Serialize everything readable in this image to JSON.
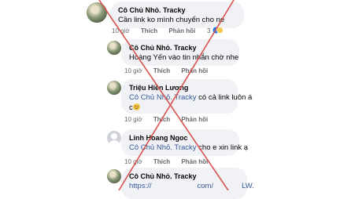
{
  "comments": [
    {
      "name": "Cô Chủ Nhỏ. Tracky",
      "text": "Cần link ko mình chuyển cho ne",
      "time": "10 giờ",
      "like": "Thích",
      "reply": "Phản hồi",
      "reaction_count": "3"
    },
    {
      "name": "Cô Chủ Nhỏ. Tracky",
      "text": "Hoàng Yến vào tin nhắn  chờ nhe",
      "time": "10 giờ",
      "like": "Thích",
      "reply": "Phản hồi"
    },
    {
      "name": "Triệu Hiền Lương",
      "mention": "Cô Chủ Nhỏ. Tracky",
      "text": " có cả link luôn á",
      "text2": "c",
      "time": "10 giờ",
      "like": "Thích",
      "reply": "Phản hồi"
    },
    {
      "name": "Linh Hoang Ngoc",
      "mention": "Cô Chủ Nhỏ. Tracky",
      "text": " cho e xin link ạ",
      "time": "10 giờ",
      "like": "Thích",
      "reply": "Phản hồi"
    },
    {
      "name": "Cô Chủ Nhỏ. Tracky",
      "link_start": "https://",
      "link_mid": "com/",
      "link_end": "LW."
    }
  ],
  "icons": {
    "reaction": "like-haha-reaction-icon",
    "emoji": "smile-emoji-icon",
    "cross": "red-x-overlay-icon"
  },
  "colors": {
    "cross": "#d9534f",
    "bubble": "#f0f2f5",
    "mention": "#385898",
    "meta": "#65676b"
  }
}
